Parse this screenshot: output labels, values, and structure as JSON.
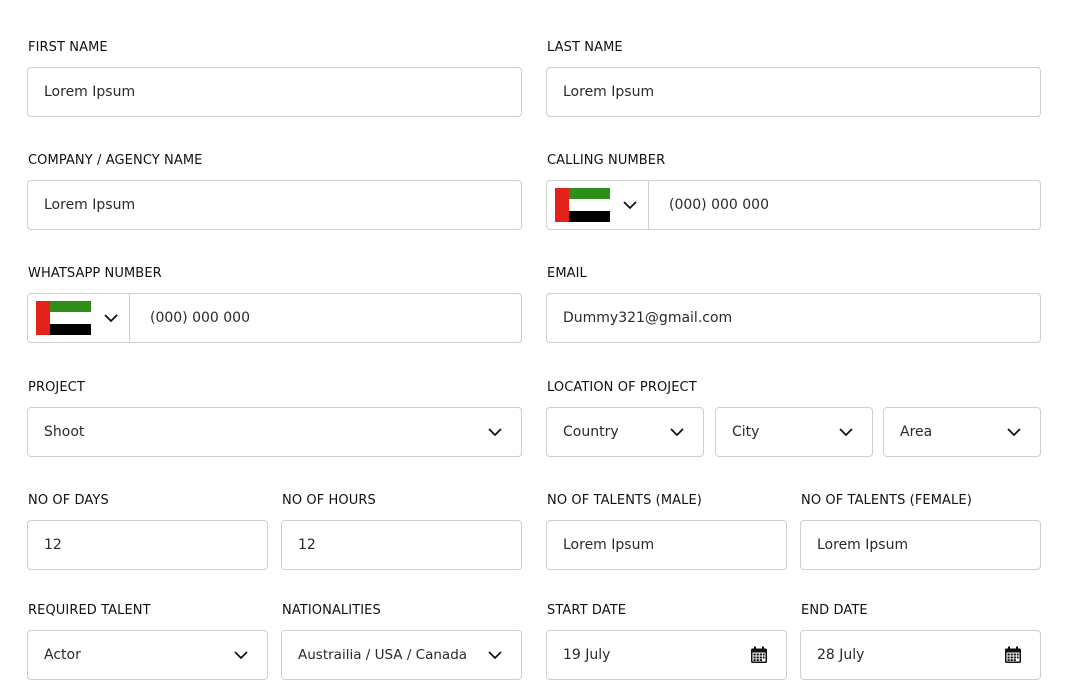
{
  "form": {
    "first_name": {
      "label": "FIRST NAME",
      "value": "Lorem Ipsum"
    },
    "last_name": {
      "label": "LAST NAME",
      "value": "Lorem Ipsum"
    },
    "company": {
      "label": "COMPANY / AGENCY NAME",
      "value": "Lorem Ipsum"
    },
    "calling_number": {
      "label": "CALLING NUMBER",
      "flag": "uae-flag-icon",
      "placeholder": "(000) 000 000"
    },
    "whatsapp_number": {
      "label": "WHATSAPP NUMBER",
      "flag": "uae-flag-icon",
      "placeholder": "(000) 000 000"
    },
    "email": {
      "label": "EMAIL",
      "value": "Dummy321@gmail.com"
    },
    "project": {
      "label": "PROJECT",
      "value": "Shoot"
    },
    "location": {
      "label": "LOCATION OF PROJECT",
      "country": "Country",
      "city": "City",
      "area": "Area"
    },
    "no_of_days": {
      "label": "NO OF DAYS",
      "value": "12"
    },
    "no_of_hours": {
      "label": "NO OF HOURS",
      "value": "12"
    },
    "talents_male": {
      "label": "NO OF TALENTS (MALE)",
      "value": "Lorem Ipsum"
    },
    "talents_female": {
      "label": "NO OF TALENTS (FEMALE)",
      "value": "Lorem Ipsum"
    },
    "required_talent": {
      "label": "REQUIRED TALENT",
      "value": "Actor"
    },
    "nationalities": {
      "label": "NATIONALITIES",
      "value": "Austrailia / USA / Canada"
    },
    "start_date": {
      "label": "START DATE",
      "value": "19 July"
    },
    "end_date": {
      "label": "END DATE",
      "value": "28 July"
    }
  },
  "colors": {
    "border": "#cfcfcf",
    "flag_red": "#e3231b",
    "flag_green": "#2e8f18",
    "flag_black": "#000000"
  }
}
